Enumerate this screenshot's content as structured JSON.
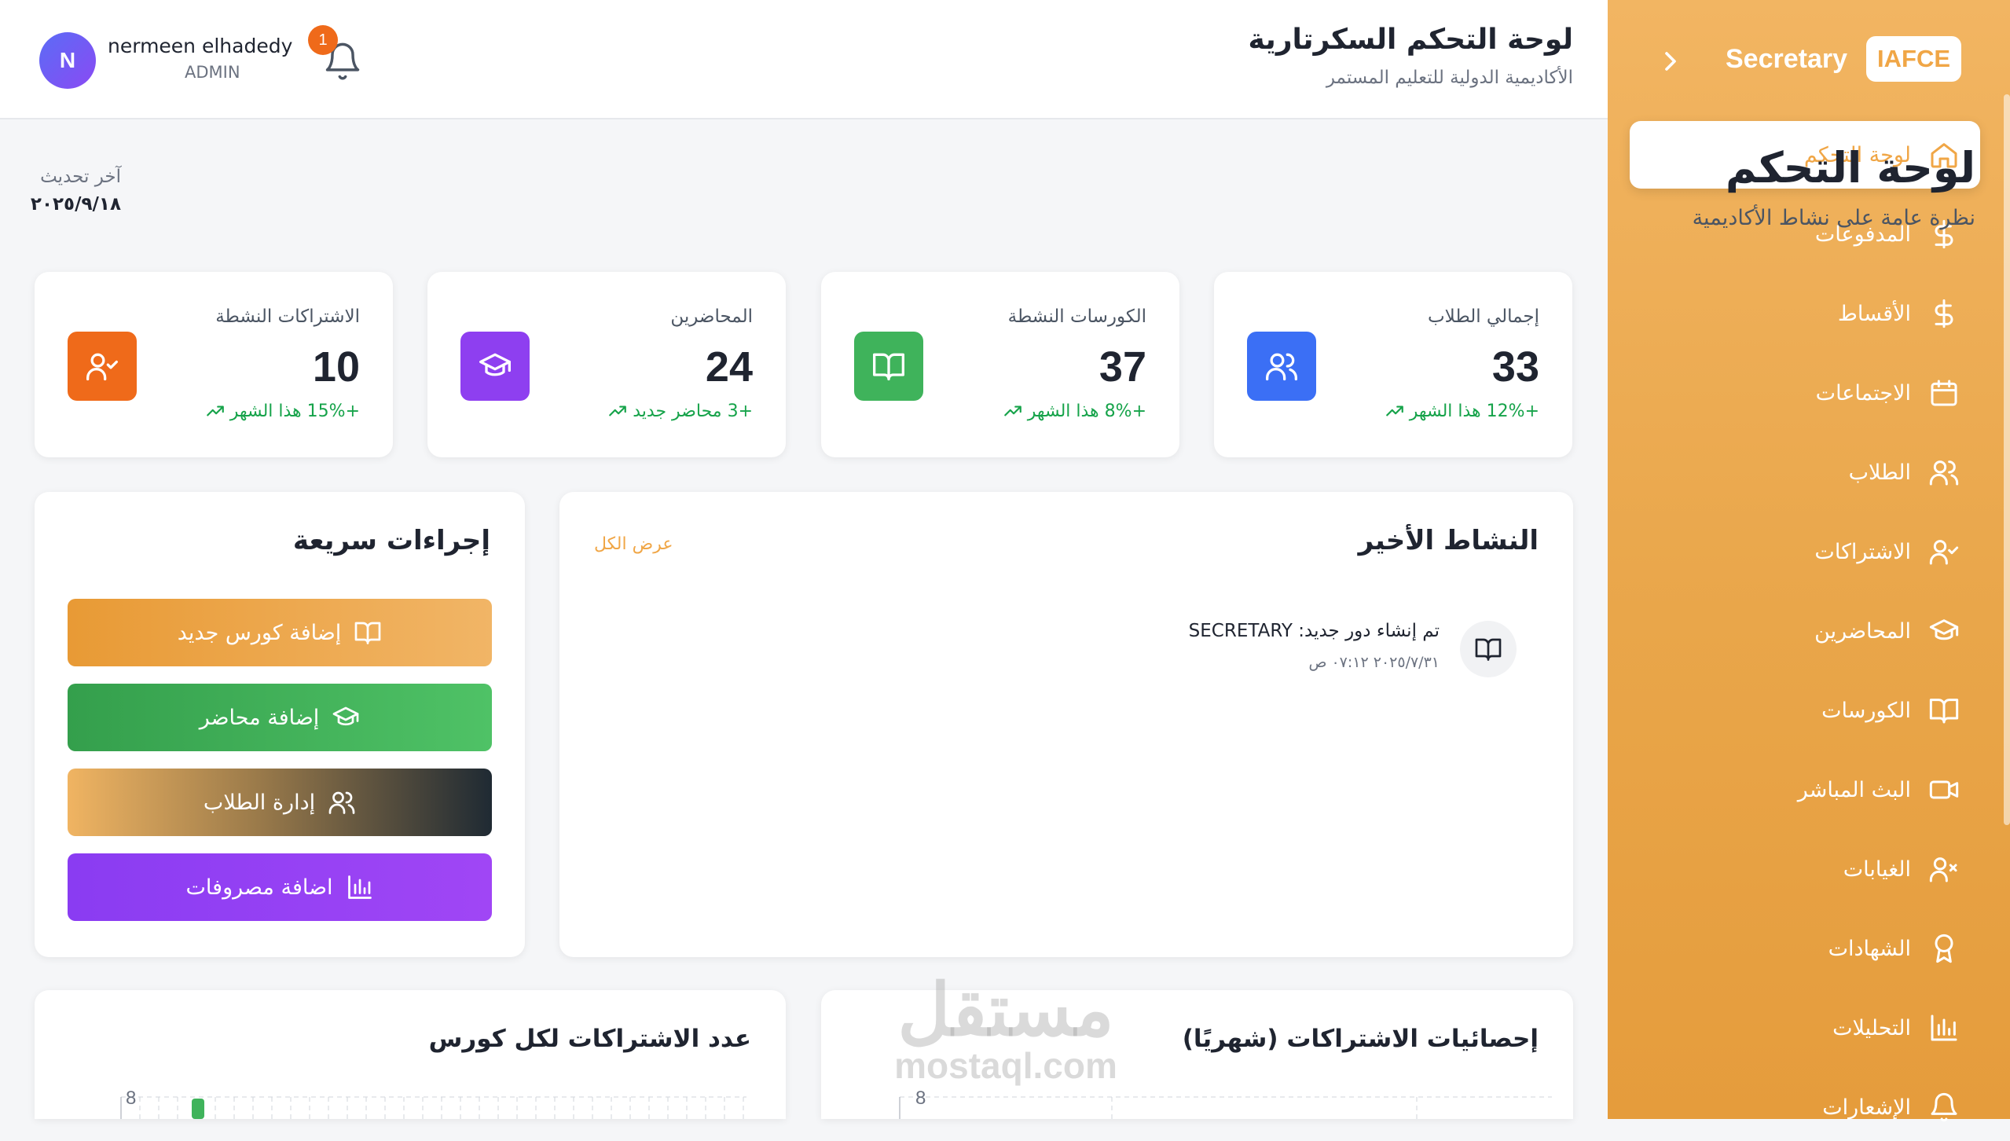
{
  "header": {
    "title": "لوحة التحكم السكرتارية",
    "subtitle": "الأكاديمية الدولية للتعليم المستمر",
    "user_initial": "N",
    "user_name": "nermeen elhadedy",
    "user_role": "ADMIN",
    "notifications_count": "1"
  },
  "sidebar": {
    "brand_name": "Secretary",
    "brand_logo": "IAFCE",
    "items": [
      {
        "label": "لوحة التحكم",
        "icon": "home-icon",
        "active": true
      },
      {
        "label": "المدفوعات",
        "icon": "dollar-icon"
      },
      {
        "label": "الأقساط",
        "icon": "dollar-icon"
      },
      {
        "label": "الاجتماعات",
        "icon": "calendar-icon"
      },
      {
        "label": "الطلاب",
        "icon": "users-icon"
      },
      {
        "label": "الاشتراكات",
        "icon": "user-check-icon"
      },
      {
        "label": "المحاضرين",
        "icon": "graduation-cap-icon"
      },
      {
        "label": "الكورسات",
        "icon": "book-icon"
      },
      {
        "label": "البث المباشر",
        "icon": "video-icon"
      },
      {
        "label": "الغيابات",
        "icon": "user-x-icon"
      },
      {
        "label": "الشهادات",
        "icon": "award-icon"
      },
      {
        "label": "التحليلات",
        "icon": "bar-chart-icon"
      },
      {
        "label": "الإشعارات",
        "icon": "bell-icon"
      }
    ]
  },
  "page": {
    "title": "لوحة التحكم",
    "subtitle": "نظرة عامة على نشاط الأكاديمية",
    "last_update_label": "آخر تحديث",
    "last_update_value": "٢٠٢٥/٩/١٨"
  },
  "stats": [
    {
      "label": "إجمالي الطلاب",
      "value": "33",
      "trend": "+12% هذا الشهر",
      "color": "#3b6ff5",
      "icon": "users-icon"
    },
    {
      "label": "الكورسات النشطة",
      "value": "37",
      "trend": "+8% هذا الشهر",
      "color": "#3fb35b",
      "icon": "book-icon"
    },
    {
      "label": "المحاضرين",
      "value": "24",
      "trend": "+3 محاضر جديد",
      "color": "#8e3ff0",
      "icon": "graduation-cap-icon"
    },
    {
      "label": "الاشتراكات النشطة",
      "value": "10",
      "trend": "+15% هذا الشهر",
      "color": "#ef6a1a",
      "icon": "user-check-icon"
    }
  ],
  "activity": {
    "title": "النشاط الأخير",
    "view_all": "عرض الكل",
    "items": [
      {
        "title": "تم إنشاء دور جديد: SECRETARY",
        "time": "٢٠٢٥/٧/٣١ ‏٠٧:١٢ ص",
        "icon": "book-icon"
      }
    ]
  },
  "quick_actions": {
    "title": "إجراءات سريعة",
    "buttons": [
      {
        "label": "إضافة كورس جديد",
        "icon": "book-icon"
      },
      {
        "label": "إضافة محاضر",
        "icon": "graduation-cap-icon"
      },
      {
        "label": "إدارة الطلاب",
        "icon": "users-icon"
      },
      {
        "label": "اضافة مصروفات",
        "icon": "bar-chart-icon"
      }
    ]
  },
  "charts": {
    "monthly_title": "إحصائيات الاشتراكات (شهريًا)",
    "per_course_title": "عدد الاشتراكات لكل كورس",
    "y_top_label": "8"
  },
  "watermark": {
    "line1": "مستقل",
    "line2": "mostaql.com"
  },
  "colors": {
    "accent": "#f0a646",
    "success": "#16a34a"
  }
}
